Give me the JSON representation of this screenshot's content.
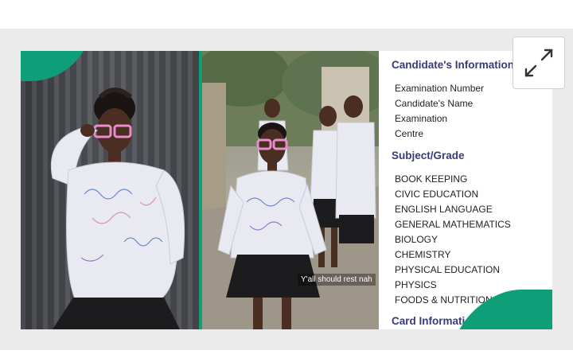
{
  "caption": "Y'all should rest nah",
  "info": {
    "candidate_title": "Candidate's Information",
    "candidate_rows": [
      "Examination Number",
      "Candidate's Name",
      "Examination",
      "Centre"
    ],
    "subject_title": "Subject/Grade",
    "subjects": [
      "BOOK KEEPING",
      "CIVIC EDUCATION",
      "ENGLISH LANGUAGE",
      "GENERAL MATHEMATICS",
      "BIOLOGY",
      "CHEMISTRY",
      "PHYSICAL EDUCATION",
      "PHYSICS",
      "FOODS & NUTRITION"
    ],
    "card_title": "Card Information"
  },
  "colors": {
    "accent": "#0e9e78",
    "title": "#3a3b7a"
  },
  "icons": {
    "expand": "expand-arrows-icon"
  }
}
